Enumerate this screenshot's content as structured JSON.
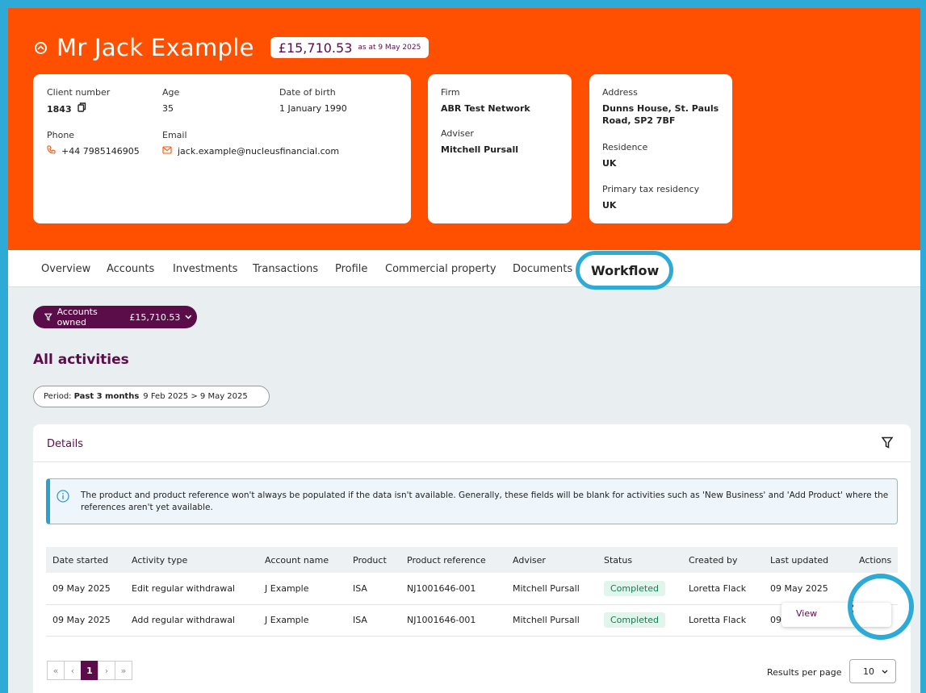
{
  "header": {
    "client_name": "Mr Jack Example",
    "value": "£15,710.53",
    "as_at": "as at 9 May 2025"
  },
  "client_card": {
    "client_number_label": "Client number",
    "client_number": "1843",
    "age_label": "Age",
    "age": "35",
    "dob_label": "Date of birth",
    "dob": "1 January 1990",
    "phone_label": "Phone",
    "phone": "+44 7985146905",
    "email_label": "Email",
    "email": "jack.example@nucleusfinancial.com"
  },
  "firm_card": {
    "firm_label": "Firm",
    "firm": "ABR Test Network",
    "adviser_label": "Adviser",
    "adviser": "Mitchell Pursall"
  },
  "address_card": {
    "address_label": "Address",
    "address": "Dunns House, St. Pauls Road, SP2 7BF",
    "residence_label": "Residence",
    "residence": "UK",
    "tax_label": "Primary tax residency",
    "tax": "UK"
  },
  "tabs": [
    "Overview",
    "Accounts",
    "Investments",
    "Transactions",
    "Profile",
    "Commercial property",
    "Documents",
    "Workflow"
  ],
  "active_tab": "Workflow",
  "filters": {
    "accounts_owned_label": "Accounts owned",
    "accounts_owned_value": "£15,710.53",
    "period_label": "Period:",
    "period_value": "Past 3 months",
    "period_dates": "9 Feb 2025  >  9 May 2025"
  },
  "section_title": "All activities",
  "panel": {
    "title": "Details",
    "info_text": "The product and product reference won't always be populated if the data isn't available. Generally, these fields will be blank for activities such as 'New Business' and 'Add Product' where the references aren't yet available."
  },
  "table": {
    "columns": [
      "Date started",
      "Activity type",
      "Account name",
      "Product",
      "Product reference",
      "Adviser",
      "Status",
      "Created by",
      "Last updated",
      "Actions"
    ],
    "rows": [
      [
        "09 May 2025",
        "Edit regular withdrawal",
        "J Example",
        "ISA",
        "NJ1001646-001",
        "Mitchell Pursall",
        "Completed",
        "Loretta Flack",
        "09 May 2025"
      ],
      [
        "09 May 2025",
        "Add regular withdrawal",
        "J Example",
        "ISA",
        "NJ1001646-001",
        "Mitchell Pursall",
        "Completed",
        "Loretta Flack",
        "09"
      ]
    ],
    "menu_item": "View"
  },
  "pagination": {
    "first": "«",
    "prev": "‹",
    "current": "1",
    "next": "›",
    "last": "»",
    "results_label": "Results per page",
    "results_value": "10"
  },
  "colors": {
    "brand_orange": "#fe5000",
    "brand_purple": "#5b0d49",
    "highlight_ring": "#2eaad6"
  }
}
